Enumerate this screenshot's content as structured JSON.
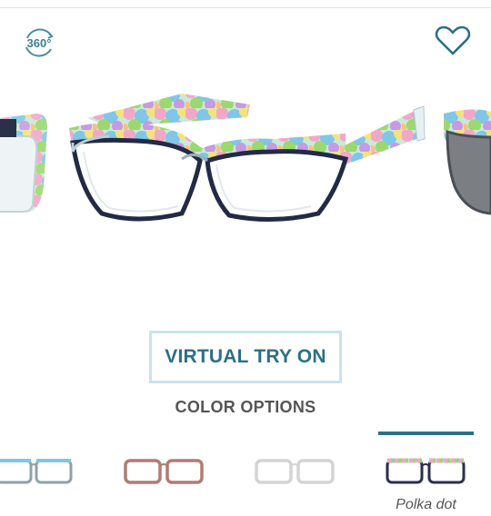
{
  "product": {
    "virtual_try_on_label": "VIRTUAL TRY ON",
    "color_options_heading": "COLOR OPTIONS",
    "icons": {
      "view_360": "360-degree-view-icon",
      "view_360_text": "360°",
      "favorite": "heart-icon"
    },
    "color_options": [
      {
        "label": "",
        "frame_color": "#8fa3a8",
        "selected": false
      },
      {
        "label": "",
        "frame_color": "#b07c73",
        "selected": false
      },
      {
        "label": "",
        "frame_color": "#d4d4d4",
        "selected": false
      },
      {
        "label": "Polka dot",
        "frame_color": "#2a2f4a",
        "selected": true
      }
    ]
  },
  "colors": {
    "accent": "#2c6f86",
    "button_border": "#c8e4ea",
    "muted_text": "#555555"
  }
}
